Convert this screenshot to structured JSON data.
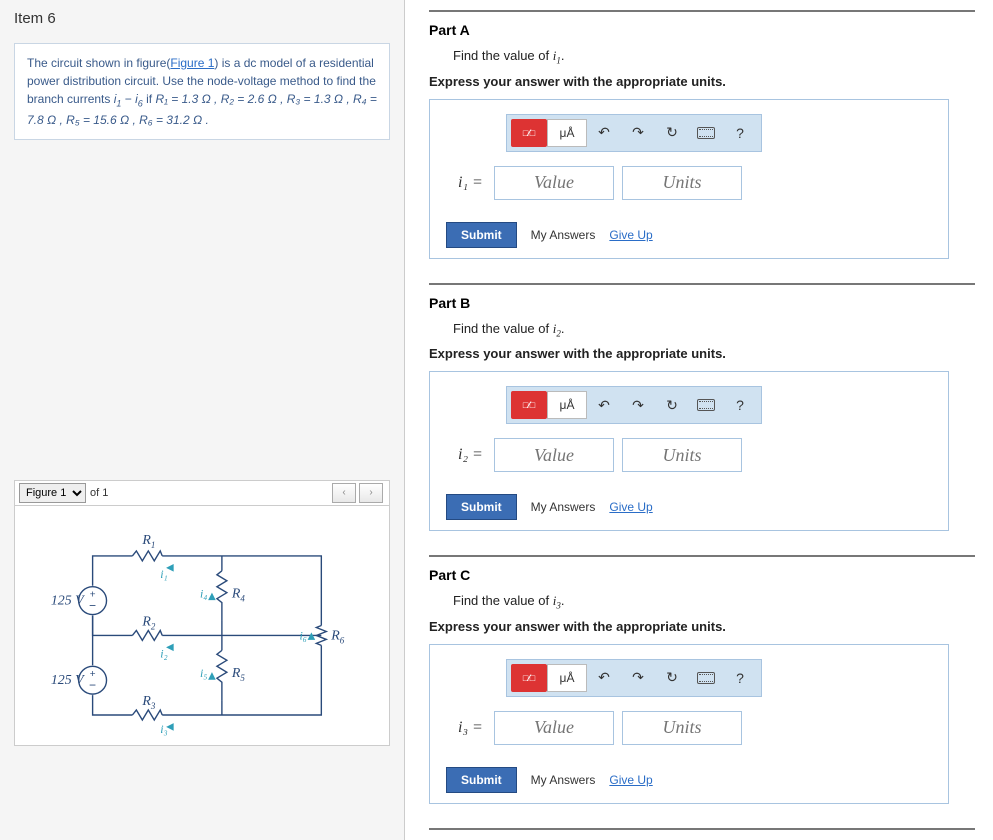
{
  "item_title": "Item 6",
  "problem": {
    "intro_a": "The circuit shown in figure(",
    "figure_link": "Figure 1",
    "intro_b": ") is a dc model of a residential power distribution circuit. Use the node-voltage method to find the branch currents ",
    "range_a": "i",
    "range_sub1": "1",
    "range_mid": " − ",
    "range_b": "i",
    "range_sub2": "6",
    "cond": " if ",
    "params": "R₁ = 1.3 Ω , R₂ = 2.6 Ω , R₃ = 1.3 Ω , R₄ = 7.8 Ω , R₅ = 15.6 Ω , R₆ = 31.2 Ω ."
  },
  "figure": {
    "select": "Figure 1",
    "of_label": "of 1",
    "v_top": "125 V",
    "v_bot": "125 V",
    "r1": "R",
    "r1s": "1",
    "r2": "R",
    "r2s": "2",
    "r3": "R",
    "r3s": "3",
    "r4": "R",
    "r4s": "4",
    "r5": "R",
    "r5s": "5",
    "r6": "R",
    "r6s": "6",
    "i1": "i₁",
    "i2": "i₂",
    "i3": "i₃",
    "i4": "i₄",
    "i5": "i₅",
    "i6": "i₆"
  },
  "toolbar": {
    "units_label": "μÅ",
    "undo": "↶",
    "redo": "↷",
    "reset": "↻",
    "help": "?"
  },
  "answers": {
    "value_ph": "Value",
    "units_ph": "Units",
    "submit": "Submit",
    "my_answers": "My Answers",
    "give_up": "Give Up"
  },
  "parts": {
    "a": {
      "title": "Part A",
      "question_a": "Find the value of ",
      "var": "i",
      "sub": "1",
      "question_b": ".",
      "instruction": "Express your answer with the appropriate units.",
      "eq_prefix": "i₁ ="
    },
    "b": {
      "title": "Part B",
      "question_a": "Find the value of ",
      "var": "i",
      "sub": "2",
      "question_b": ".",
      "instruction": "Express your answer with the appropriate units.",
      "eq_prefix": "i₂ ="
    },
    "c": {
      "title": "Part C",
      "question_a": "Find the value of ",
      "var": "i",
      "sub": "3",
      "question_b": ".",
      "instruction": "Express your answer with the appropriate units.",
      "eq_prefix": "i₃ ="
    }
  }
}
